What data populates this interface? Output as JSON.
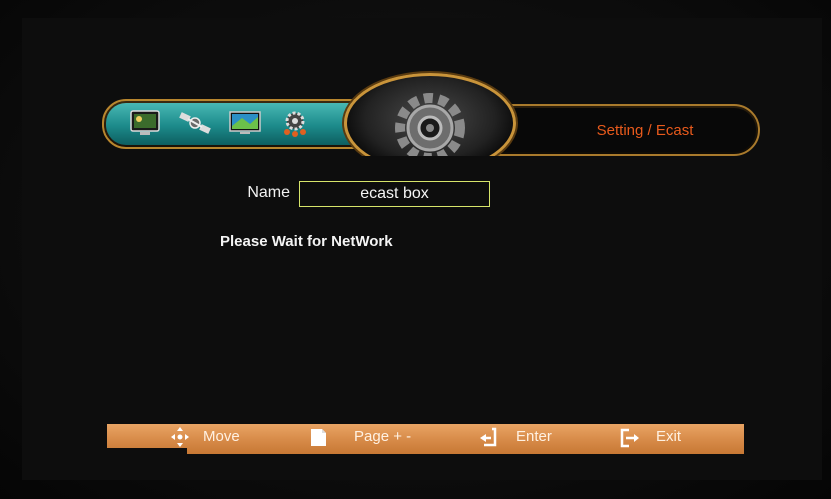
{
  "header": {
    "breadcrumb": "Setting / Ecast",
    "menu_icons": [
      "tv-menu-icon",
      "satellite-icon",
      "monitor-icon",
      "gear-settings-icon"
    ],
    "center_icon": "gear-icon"
  },
  "form": {
    "name_label": "Name",
    "name_value": "ecast box",
    "status": "Please Wait for NetWork"
  },
  "helpbar": {
    "move": "Move",
    "page": "Page + -",
    "enter": "Enter",
    "exit": "Exit"
  },
  "colors": {
    "accent_orange": "#e85a1c",
    "banner_teal": "#1c8a8a",
    "helpbar": "#d88c4a",
    "input_border": "#d6e46a"
  }
}
